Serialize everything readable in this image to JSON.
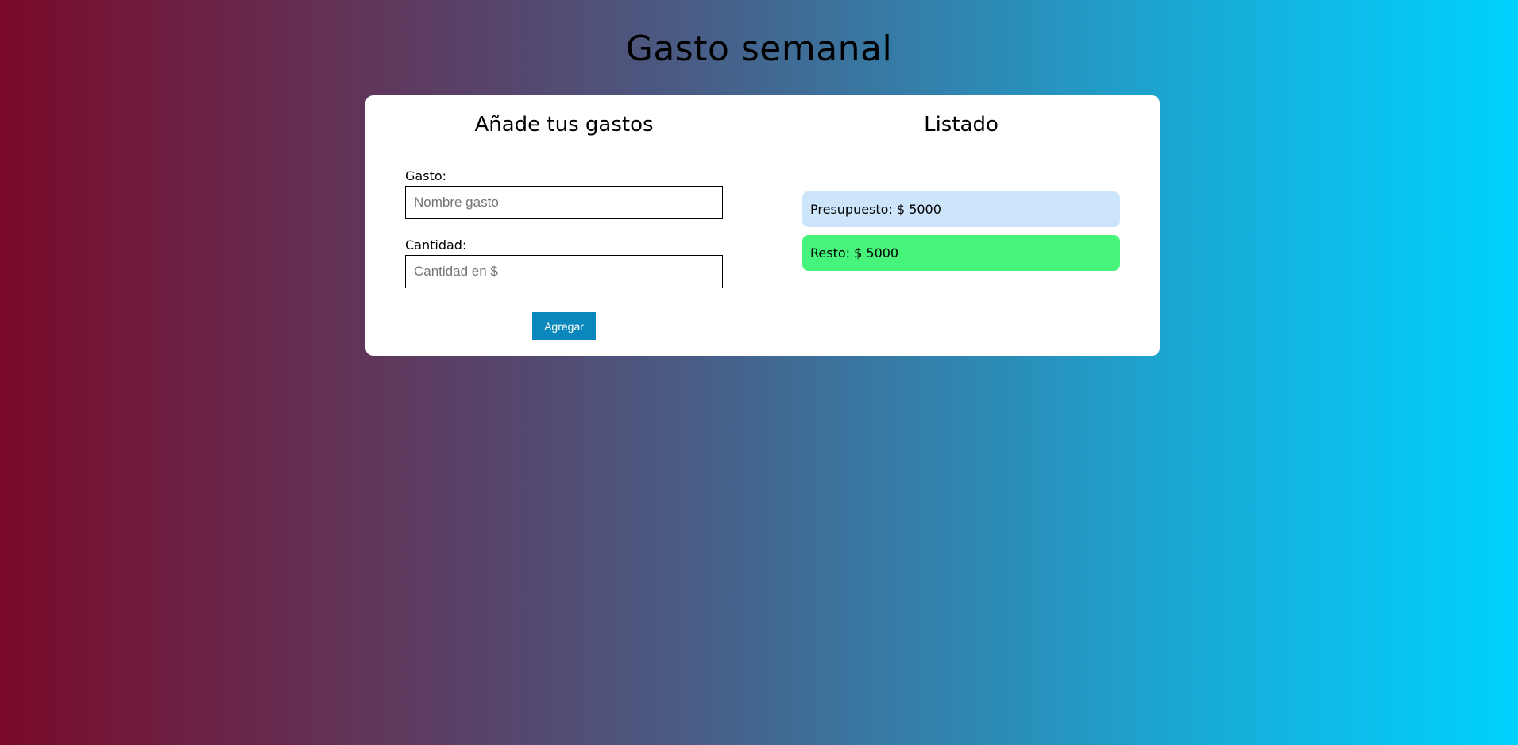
{
  "header": {
    "title": "Gasto semanal"
  },
  "form": {
    "title": "Añade tus gastos",
    "expense_label": "Gasto:",
    "expense_placeholder": "Nombre gasto",
    "expense_value": "",
    "amount_label": "Cantidad:",
    "amount_placeholder": "Cantidad en $",
    "amount_value": "",
    "submit_label": "Agregar"
  },
  "list": {
    "title": "Listado",
    "budget_text": "Presupuesto: $ 5000",
    "rest_text": "Resto: $ 5000"
  },
  "colors": {
    "button": "#0a88bd",
    "budget_box": "#cce5fa",
    "rest_box": "#46f47c",
    "gradient_start": "#7a0a2a",
    "gradient_end": "#00d2ff"
  }
}
